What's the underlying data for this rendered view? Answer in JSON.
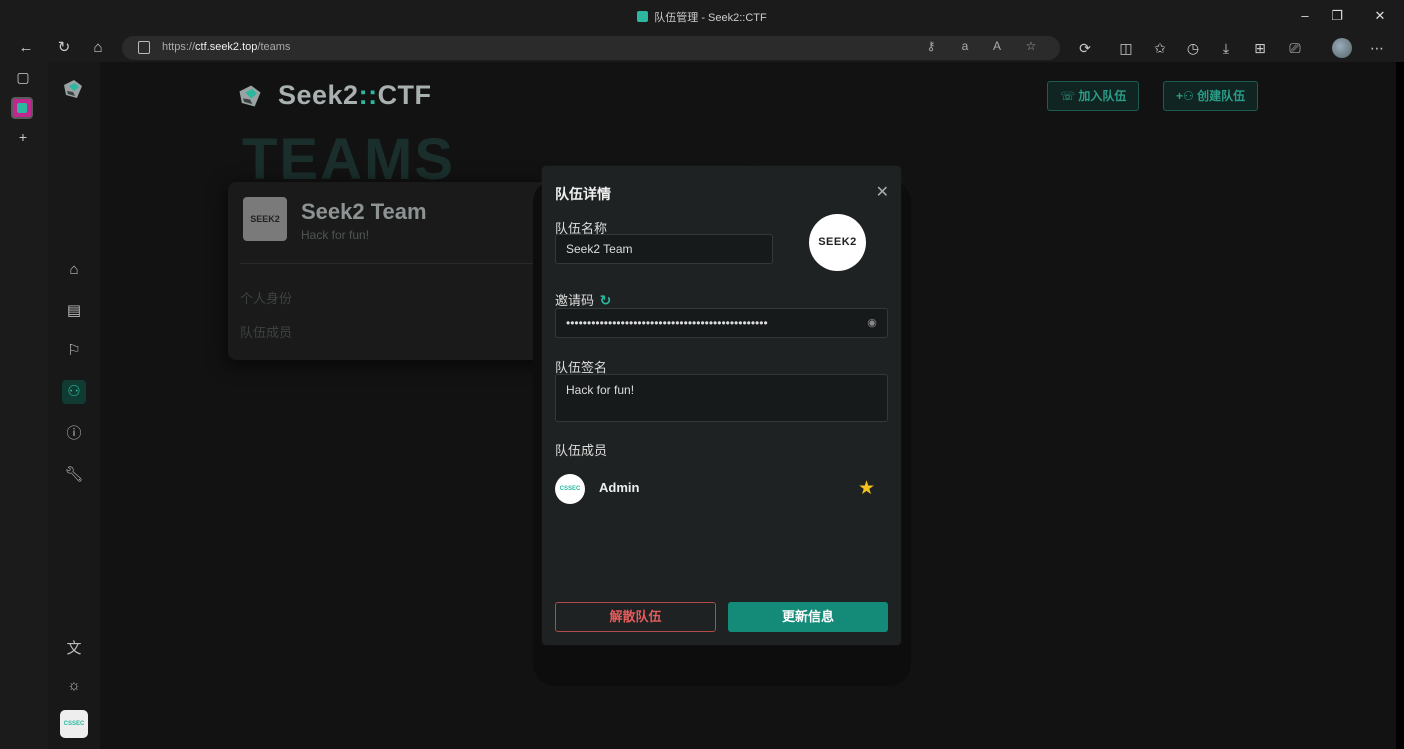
{
  "browser": {
    "tab_title": "队伍管理 - Seek2::CTF",
    "url_prefix": "https://",
    "url_host": "ctf.seek2.top",
    "url_path": "/teams",
    "window_controls": [
      "–",
      "❐",
      "✕"
    ]
  },
  "app": {
    "brand_prefix": "Seek2",
    "brand_colons": "::",
    "brand_suffix": "CTF",
    "join_team_label": "加入队伍",
    "create_team_label": "创建队伍",
    "background_heading": "TEAMS",
    "user_badge": "CSSEC",
    "accent_color": "#2cb8a0"
  },
  "team_card": {
    "logo_text": "SEEK2",
    "name": "Seek2 Team",
    "slogan": "Hack for fun!",
    "role_label": "个人身份",
    "members_label": "队伍成员"
  },
  "modal": {
    "title": "队伍详情",
    "name_label": "队伍名称",
    "name_value": "Seek2 Team",
    "avatar_text": "SEEK2",
    "invite_label": "邀请码",
    "invite_value": "••••••••••••••••••••••••••••••••••••••••••••••••",
    "slogan_label": "队伍签名",
    "slogan_value": "Hack for fun!",
    "members_label": "队伍成员",
    "members": [
      {
        "avatar": "CSSEC",
        "name": "Admin",
        "is_captain": true
      }
    ],
    "dissolve_label": "解散队伍",
    "update_label": "更新信息"
  }
}
